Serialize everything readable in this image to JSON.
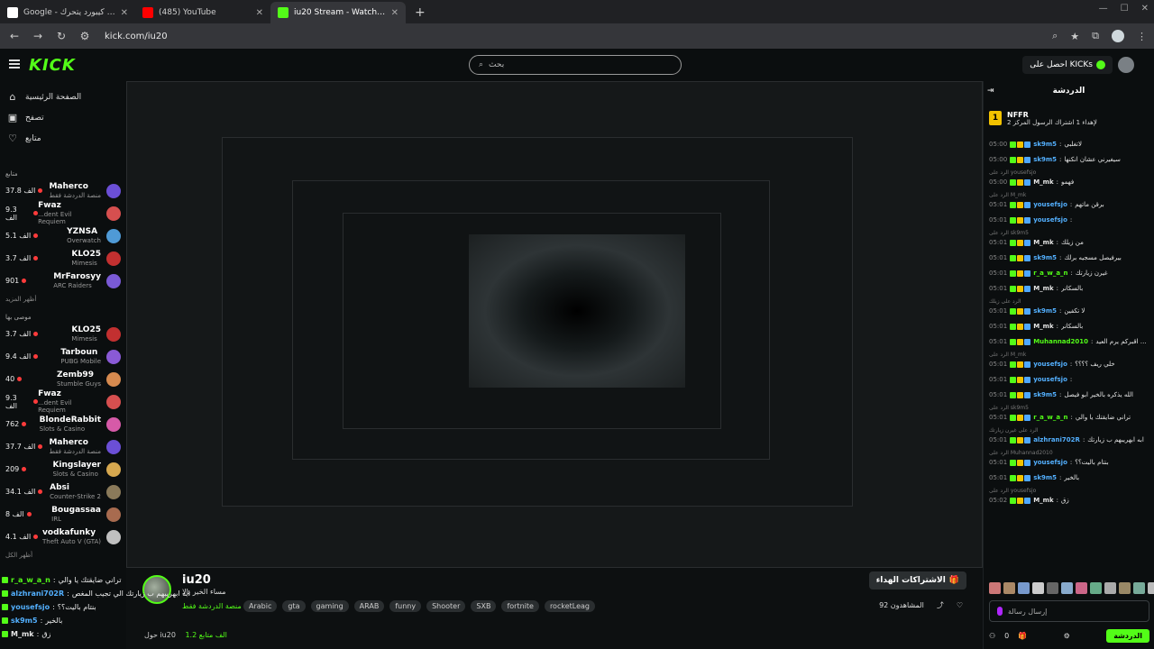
{
  "browser": {
    "tabs": [
      {
        "label": "Google - بحث كيبورد يتحرك",
        "favicon": "google"
      },
      {
        "label": "(485) YouTube",
        "favicon": "youtube"
      },
      {
        "label": "iu20 Stream - Watch Live on Kick",
        "favicon": "kick",
        "active": true
      }
    ],
    "new_tab": "+",
    "url": "kick.com/iu20"
  },
  "header": {
    "logo": "KICK",
    "search_placeholder": "بحث",
    "get_kicks": "احصل على KICKs"
  },
  "sidebar": {
    "nav": [
      {
        "label": "الصفحة الرئيسية",
        "icon": "home-icon"
      },
      {
        "label": "تصفح",
        "icon": "browse-icon"
      },
      {
        "label": "متابع",
        "icon": "heart-icon"
      }
    ],
    "following_title": "متابع",
    "following": [
      {
        "name": "Maherco",
        "sub": "منصة الدردشة فقط",
        "viewers": "37.8 الف",
        "color": "#6b4fd6"
      },
      {
        "name": "Fwaz",
        "sub": "...dent Evil Requiem",
        "viewers": "9.3 الف",
        "color": "#d64f4f"
      },
      {
        "name": "YZNSA",
        "sub": "Overwatch",
        "viewers": "5.1 الف",
        "color": "#4f9ad6"
      },
      {
        "name": "KLO25",
        "sub": "Mimesis",
        "viewers": "3.7 الف",
        "color": "#c23030"
      },
      {
        "name": "MrFarosyy",
        "sub": "ARC Raiders",
        "viewers": "901",
        "color": "#7a5ad6"
      }
    ],
    "show_more_1": "أظهر المزيد",
    "recommended_title": "موصى بها",
    "recommended": [
      {
        "name": "KLO25",
        "sub": "Mimesis",
        "viewers": "3.7 الف",
        "color": "#c23030"
      },
      {
        "name": "Tarboun",
        "sub": "PUBG Mobile",
        "viewers": "9.4 الف",
        "color": "#8a5ad6"
      },
      {
        "name": "Zemb99",
        "sub": "Stumble Guys",
        "viewers": "40",
        "color": "#d68a4f"
      },
      {
        "name": "Fwaz",
        "sub": "...dent Evil Requiem",
        "viewers": "9.3 الف",
        "color": "#d64f4f"
      },
      {
        "name": "BlondeRabbit",
        "sub": "Slots & Casino",
        "viewers": "762",
        "color": "#d65aa8"
      },
      {
        "name": "Maherco",
        "sub": "منصة الدردشة فقط",
        "viewers": "37.7 الف",
        "color": "#6b4fd6"
      },
      {
        "name": "Kingslayer",
        "sub": "Slots & Casino",
        "viewers": "209",
        "color": "#d6a84f"
      },
      {
        "name": "Absi",
        "sub": "Counter-Strike 2",
        "viewers": "34.1 الف",
        "color": "#8a7a5a"
      },
      {
        "name": "Bougassaa",
        "sub": "IRL",
        "viewers": "8 الف",
        "color": "#a86b4f"
      },
      {
        "name": "vodkafunky",
        "sub": "Theft Auto V (GTA)",
        "viewers": "4.1 الف",
        "color": "#c0c0c0"
      }
    ],
    "show_all": "أظهر الكل"
  },
  "stream": {
    "name": "iu20",
    "title": "مساء الخير يالا",
    "category": "منصة الدردشة فقط",
    "tags": [
      "Arabic",
      "gta",
      "gaming",
      "ARAB",
      "funny",
      "Shooter",
      "SXB",
      "fortnite",
      "rocketLeag"
    ],
    "subscribe_label": "الاشتراكات الهداء",
    "viewers_label": "المشاهدون 92",
    "about_label": "حول iu20",
    "followers": "1.2 الف متابع"
  },
  "overlay_chat": [
    {
      "user": "r_a_w_a_n",
      "text": "تراني ضايقتك يا والي",
      "color": "#53fc18"
    },
    {
      "user": "alzhrani702R",
      "text": "ابه ابهريبهم ب زيارتك الي تجيب المغص",
      "color": "#53b0ff"
    },
    {
      "user": "yousefsjo",
      "text": "بنتام باليت؟؟",
      "color": "#53b0ff"
    },
    {
      "user": "sk9m5",
      "text": "بالخير",
      "color": "#53b0ff"
    },
    {
      "user": "M_mk",
      "text": "زق",
      "color": "#e6e6e6"
    }
  ],
  "chat": {
    "title": "الدردشة",
    "pinned_user": "NFFR",
    "pinned_text": "لإهداء 1 اشتراك الرسول المركز 2",
    "messages": [
      {
        "time": "05:00",
        "user": "sk9m5",
        "text": "لاتغلبي",
        "color": "#53b0ff"
      },
      {
        "time": "05:00",
        "user": "sk9m5",
        "text": "سيغيرني عشان انكنها",
        "color": "#53b0ff"
      },
      {
        "time": "05:00",
        "user": "M_mk",
        "text": "فهمو",
        "color": "#e6e6e6",
        "reply": "الرد على yousefsjo"
      },
      {
        "time": "05:01",
        "user": "yousefsjo",
        "text": "برقن ماتهم",
        "color": "#53b0ff",
        "reply": "الرد على M_mk"
      },
      {
        "time": "05:01",
        "user": "yousefsjo",
        "text": "",
        "color": "#53b0ff"
      },
      {
        "time": "05:01",
        "user": "M_mk",
        "text": "من زيلك",
        "color": "#e6e6e6",
        "reply": "الرد على sk9m5"
      },
      {
        "time": "05:01",
        "user": "sk9m5",
        "text": "بيرفيصل مسجيه برلك",
        "color": "#53b0ff"
      },
      {
        "time": "05:01",
        "user": "r_a_w_a_n",
        "text": "غيرن زيارتك",
        "color": "#53fc18"
      },
      {
        "time": "05:01",
        "user": "M_mk",
        "text": "بالسكانر",
        "color": "#e6e6e6"
      },
      {
        "time": "05:01",
        "user": "sk9m5",
        "text": "لا تكفين",
        "color": "#53b0ff",
        "reply": "الرد على زيلك"
      },
      {
        "time": "05:01",
        "user": "M_mk",
        "text": "بالسكانر",
        "color": "#e6e6e6"
      },
      {
        "time": "05:01",
        "user": "Muhannad2010",
        "text": "يلا راح اقبركم يرم العيد",
        "color": "#53fc18"
      },
      {
        "time": "05:01",
        "user": "yousefsjo",
        "text": "خلي ريف ؟؟؟؟",
        "color": "#53b0ff",
        "reply": "الرد على M_mk"
      },
      {
        "time": "05:01",
        "user": "yousefsjo",
        "text": "",
        "color": "#53b0ff"
      },
      {
        "time": "05:01",
        "user": "sk9m5",
        "text": "الله يذكره بالخير ابو فيصل",
        "color": "#53b0ff"
      },
      {
        "time": "05:01",
        "user": "r_a_w_a_n",
        "text": "تراني ضايقتك يا والي",
        "color": "#53fc18",
        "reply": "الرد على sk9m5"
      },
      {
        "time": "05:01",
        "user": "alzhrani702R",
        "text": "ابه ابهريبهم ب زيارتك",
        "color": "#53b0ff",
        "reply": "الرد على غيرن زيارتك"
      },
      {
        "time": "05:01",
        "user": "yousefsjo",
        "text": "بنتام باليت؟؟",
        "color": "#53b0ff",
        "reply": "الرد على Muhannad2010"
      },
      {
        "time": "05:01",
        "user": "sk9m5",
        "text": "بالخير",
        "color": "#53b0ff"
      },
      {
        "time": "05:02",
        "user": "M_mk",
        "text": "زق",
        "color": "#e6e6e6",
        "reply": "الرد على yousefsjo"
      }
    ],
    "emote_label": "المتبعين فقط",
    "input_placeholder": "إرسال رسالة",
    "send_label": "الدردشة",
    "kicks_count": "0"
  }
}
